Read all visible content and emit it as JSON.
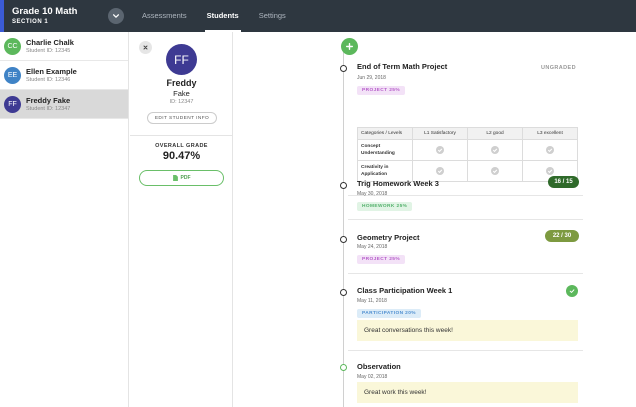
{
  "course": {
    "title": "Grade 10 Math",
    "section": "SECTION 1"
  },
  "tabs": [
    {
      "label": "Assessments",
      "active": false
    },
    {
      "label": "Students",
      "active": true
    },
    {
      "label": "Settings",
      "active": false
    }
  ],
  "students": [
    {
      "initials": "CC",
      "name": "Charlie Chalk",
      "sid": "Student ID: 12345",
      "color": "#5cb85c"
    },
    {
      "initials": "EE",
      "name": "Ellen Example",
      "sid": "Student ID: 12346",
      "color": "#3f83c6"
    },
    {
      "initials": "FF",
      "name": "Freddy Fake",
      "sid": "Student ID: 12347",
      "color": "#3e3a93"
    }
  ],
  "profile": {
    "initials": "FF",
    "first_name": "Freddy",
    "last_name": "Fake",
    "id_label": "ID: 12347",
    "edit_label": "EDIT STUDENT INFO",
    "overall_label": "OVERALL GRADE",
    "overall_value": "90.47%",
    "pdf_label": "PDF"
  },
  "entries": [
    {
      "title": "End of Term Math Project",
      "date": "Jun 29, 2018",
      "tag": "PROJECT 25%",
      "status": "UNGRADED",
      "rubric": {
        "headers": [
          "Categories / Levels",
          "L1 Satisfactory",
          "L2 good",
          "L3 excellent"
        ],
        "rows": [
          "Concept Understanding",
          "Creativity in Application"
        ]
      }
    },
    {
      "title": "Trig Homework Week 3",
      "date": "May 30, 2018",
      "tag": "HOMEWORK 25%",
      "score": "16 / 15"
    },
    {
      "title": "Geometry Project",
      "date": "May 24, 2018",
      "tag": "PROJECT 25%",
      "score": "22 / 30"
    },
    {
      "title": "Class Participation Week 1",
      "date": "May 11, 2018",
      "tag": "PARTICIPATION 20%",
      "comment": "Great conversations this week!"
    },
    {
      "title": "Observation",
      "date": "May 02, 2018",
      "comment": "Great work this week!"
    }
  ]
}
